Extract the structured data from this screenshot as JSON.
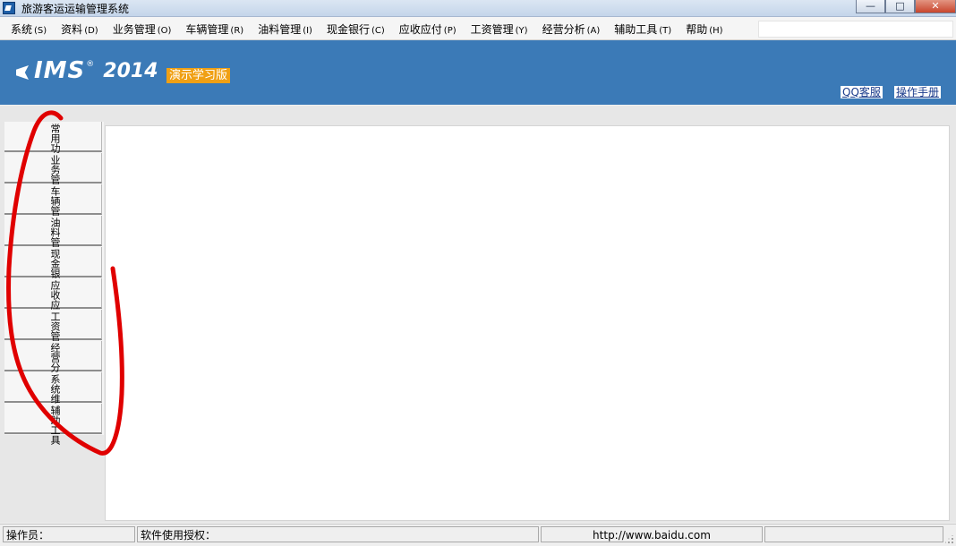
{
  "window": {
    "title": "旅游客运运输管理系统",
    "controls": {
      "minimize": "—",
      "maximize": "□",
      "close": "✕"
    }
  },
  "menu": [
    {
      "label": "系统",
      "hotkey": "(S)"
    },
    {
      "label": "资料",
      "hotkey": "(D)"
    },
    {
      "label": "业务管理",
      "hotkey": "(O)"
    },
    {
      "label": "车辆管理",
      "hotkey": "(R)"
    },
    {
      "label": "油料管理",
      "hotkey": "(I)"
    },
    {
      "label": "现金银行",
      "hotkey": "(C)"
    },
    {
      "label": "应收应付",
      "hotkey": "(P)"
    },
    {
      "label": "工资管理",
      "hotkey": "(Y)"
    },
    {
      "label": "经营分析",
      "hotkey": "(A)"
    },
    {
      "label": "辅助工具",
      "hotkey": "(T)"
    },
    {
      "label": "帮助",
      "hotkey": "(H)"
    }
  ],
  "banner": {
    "logo_text": "IMS",
    "logo_reg": "®",
    "logo_year": "2014",
    "edition": "演示学习版",
    "qq_link": "QQ客服",
    "manual_link": "操作手册",
    "background_color": "#3b7ab7",
    "edition_color": "#f0a014"
  },
  "side_nav": [
    {
      "label": "常用功能"
    },
    {
      "label": "业务管理"
    },
    {
      "label": "车辆管理"
    },
    {
      "label": "油料管理"
    },
    {
      "label": "现金银行"
    },
    {
      "label": "应收应付"
    },
    {
      "label": "工资管理"
    },
    {
      "label": "经营分析"
    },
    {
      "label": "系统维护"
    },
    {
      "label": "辅助工具"
    }
  ],
  "status": {
    "operator": "操作员：",
    "license": "软件使用授权：",
    "url": "http://www.baidu.com",
    "extra": ""
  },
  "annotation_color": "#e00000"
}
